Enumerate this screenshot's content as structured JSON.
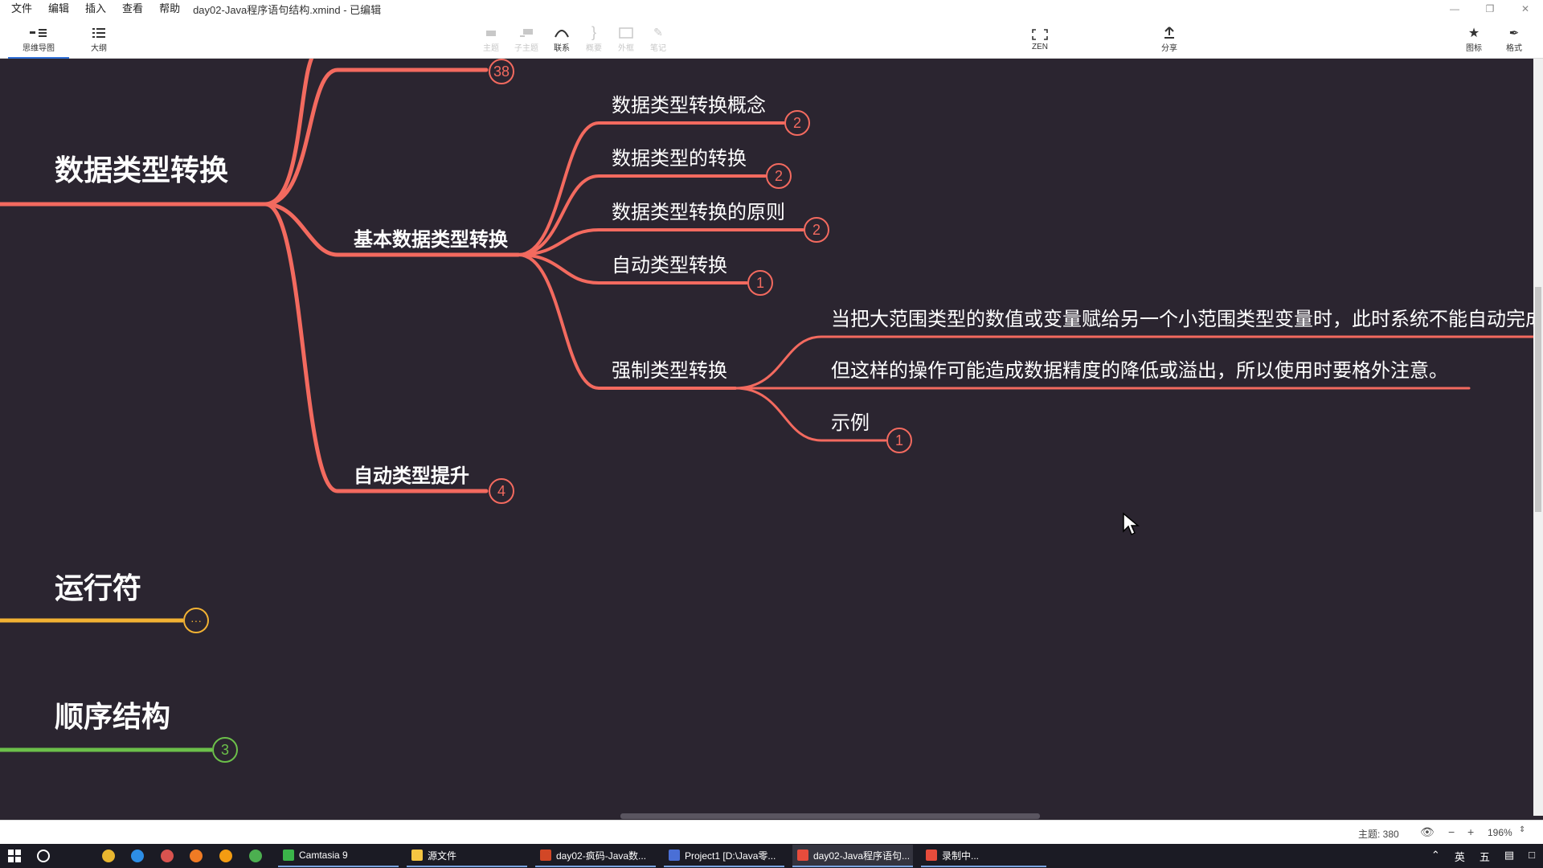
{
  "menubar": {
    "items": [
      "文件",
      "编辑",
      "插入",
      "查看",
      "帮助"
    ],
    "title": "day02-Java程序语句结构.xmind - 已编辑"
  },
  "toolbar": {
    "mindmap": "思维导图",
    "outline": "大纲",
    "topic": "主题",
    "subtopic": "子主题",
    "relation": "联系",
    "summary": "概要",
    "boundary": "外框",
    "note": "笔记",
    "zen": "ZEN",
    "share": "分享",
    "icons": "图标",
    "format": "格式"
  },
  "mindmap": {
    "colors": {
      "red": "#f36a5f",
      "yellow": "#f2b233",
      "green": "#6cc04a",
      "background": "#2b2530"
    },
    "main_topics": [
      {
        "label": "数据类型转换",
        "color": "red"
      },
      {
        "label": "运行符",
        "color": "yellow",
        "badge": "···"
      },
      {
        "label": "顺序结构",
        "color": "green",
        "badge": "3"
      }
    ],
    "top_hidden_badge": "38",
    "sub_topics": [
      {
        "label": "基本数据类型转换"
      },
      {
        "label": "自动类型提升",
        "badge": "4"
      }
    ],
    "leaves": [
      {
        "label": "数据类型转换概念",
        "badge": "2"
      },
      {
        "label": "数据类型的转换",
        "badge": "2"
      },
      {
        "label": "数据类型转换的原则",
        "badge": "2"
      },
      {
        "label": "自动类型转换",
        "badge": "1"
      },
      {
        "label": "强制类型转换"
      }
    ],
    "cast_details": [
      {
        "label": "当把大范围类型的数值或变量赋给另一个小范围类型变量时，此时系统不能自动完成转"
      },
      {
        "label": "但这样的操作可能造成数据精度的降低或溢出，所以使用时要格外注意。"
      },
      {
        "label": "示例",
        "badge": "1"
      }
    ]
  },
  "statusbar": {
    "topic_count": "主题: 380",
    "zoom": "196%"
  },
  "taskbar": {
    "apps": [
      "Camtasia 9",
      "源文件",
      "day02-疯码-Java数...",
      "Project1 [D:\\Java零...",
      "day02-Java程序语句...",
      "录制中..."
    ],
    "tray_lang": "英",
    "tray_ime": "五"
  }
}
